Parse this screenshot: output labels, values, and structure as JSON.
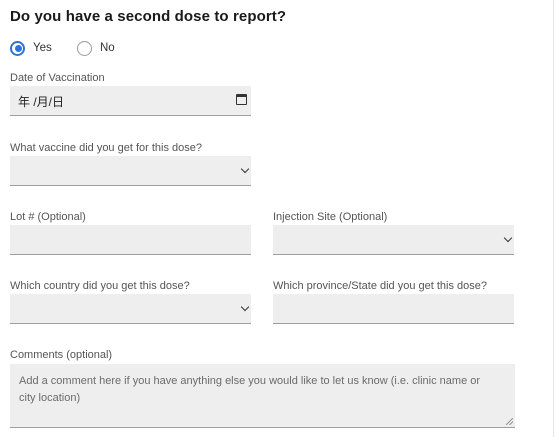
{
  "question": "Do you have a second dose to report?",
  "radios": {
    "yes_label": "Yes",
    "no_label": "No",
    "selected": "Yes"
  },
  "date": {
    "label": "Date of Vaccination",
    "value": "年 /月/日"
  },
  "vaccine": {
    "label": "What vaccine did you get for this dose?",
    "value": ""
  },
  "lot": {
    "label": "Lot # (Optional)",
    "value": ""
  },
  "injection_site": {
    "label": "Injection Site (Optional)",
    "value": ""
  },
  "country": {
    "label": "Which country did you get this dose?",
    "value": ""
  },
  "province": {
    "label": "Which province/State did you get this dose?",
    "value": ""
  },
  "comments": {
    "label": "Comments (optional)",
    "placeholder": "Add a comment here if you have anything else you would like to let us know (i.e. clinic name or city location)"
  },
  "colors": {
    "accent": "#2f73d7",
    "field_bg": "#eeeeee",
    "field_border": "#9e9e9e"
  }
}
